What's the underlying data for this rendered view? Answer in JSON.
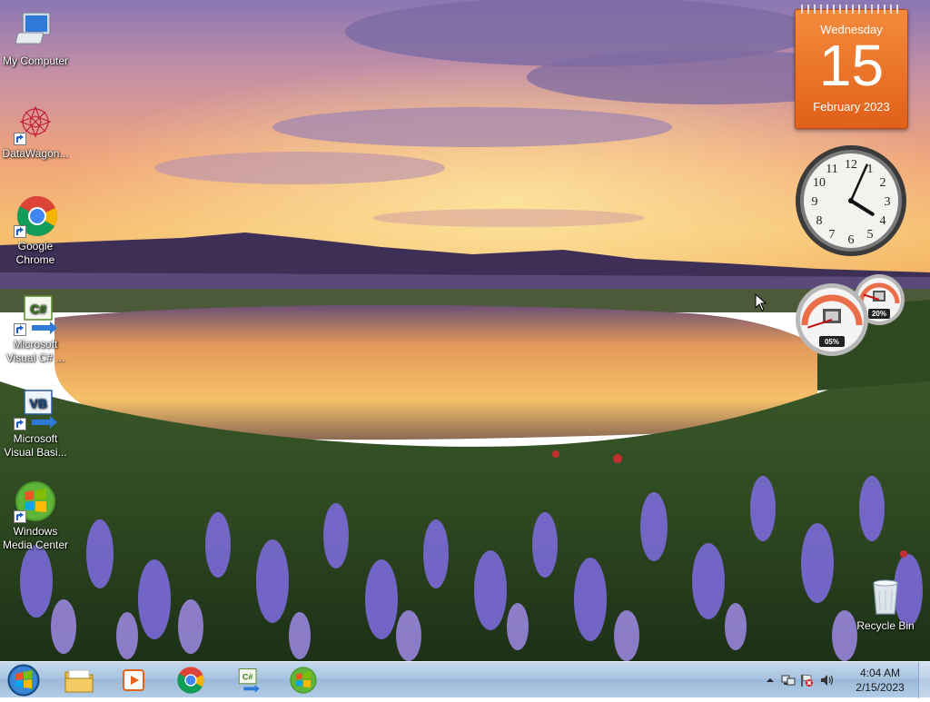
{
  "desktop": {
    "icons": [
      {
        "label": "My Computer",
        "icon": "computer-icon"
      },
      {
        "label": "DataWagon...",
        "icon": "datawagon-icon"
      },
      {
        "label": "Google Chrome",
        "icon": "chrome-icon"
      },
      {
        "label": "Microsoft Visual C# ...",
        "icon": "visual-csharp-icon"
      },
      {
        "label": "Microsoft Visual Basi...",
        "icon": "visual-basic-icon"
      },
      {
        "label": "Windows Media Center",
        "icon": "media-center-icon"
      },
      {
        "label": "Recycle Bin",
        "icon": "recycle-bin-icon"
      }
    ]
  },
  "gadgets": {
    "calendar": {
      "weekday": "Wednesday",
      "day": "15",
      "month_year": "February 2023"
    },
    "clock": {
      "hour": 4,
      "minute": 4
    },
    "cpu_meter": {
      "cpu": "05%",
      "memory": "20%",
      "cpu_value": 5,
      "memory_value": 20
    }
  },
  "taskbar": {
    "apps": [
      {
        "name": "windows-explorer",
        "icon": "folder-icon"
      },
      {
        "name": "media-player",
        "icon": "media-player-icon"
      },
      {
        "name": "google-chrome",
        "icon": "chrome-icon"
      },
      {
        "name": "visual-csharp",
        "icon": "visual-csharp-icon"
      },
      {
        "name": "media-center",
        "icon": "media-center-icon"
      }
    ],
    "tray": {
      "time": "4:04 AM",
      "date": "2/15/2023"
    }
  },
  "colors": {
    "taskbar": "#a9c4e0",
    "calendar": "#e8702a",
    "sky_top": "#8a77b5",
    "sunset": "#f3b060"
  }
}
